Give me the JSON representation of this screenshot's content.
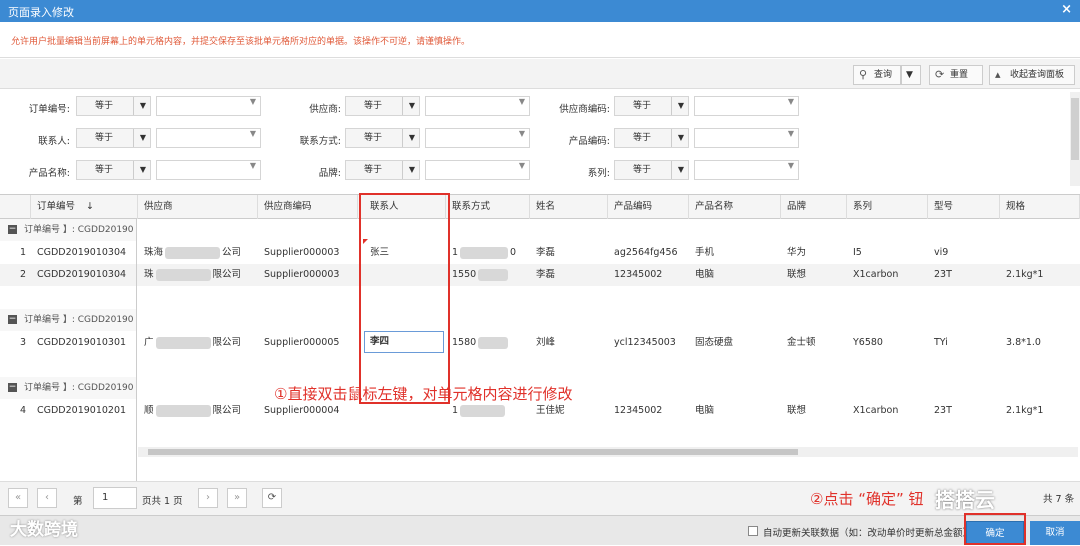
{
  "window": {
    "title": "页面录入修改",
    "close": "×"
  },
  "notice": "允许用户批量编辑当前屏幕上的单元格内容，并提交保存至该批单元格所对应的单据。该操作不可逆，请谨慎操作。",
  "toolbar": {
    "query": "查询",
    "reset": "重置",
    "collapse": "收起查询面板"
  },
  "filters": [
    {
      "label": "订单编号:",
      "op": "等于"
    },
    {
      "label": "供应商:",
      "op": "等于"
    },
    {
      "label": "供应商编码:",
      "op": "等于"
    },
    {
      "label": "联系人:",
      "op": "等于"
    },
    {
      "label": "联系方式:",
      "op": "等于"
    },
    {
      "label": "产品编码:",
      "op": "等于"
    },
    {
      "label": "产品名称:",
      "op": "等于"
    },
    {
      "label": "品牌:",
      "op": "等于"
    },
    {
      "label": "系列:",
      "op": "等于"
    }
  ],
  "table": {
    "headers": [
      "订单编号",
      "供应商",
      "供应商编码",
      "联系人",
      "联系方式",
      "姓名",
      "产品编码",
      "产品名称",
      "品牌",
      "系列",
      "型号",
      "规格"
    ],
    "sort_icon": "↓",
    "group_label": "订单编号",
    "groups": [
      "订单编号 】: CGDD20190",
      "订单编号 】: CGDD20190",
      "订单编号 】: CGDD20190"
    ],
    "rows": [
      {
        "n": "1",
        "order": "CGDD2019010304",
        "sup_a": "珠海",
        "sup_b": "公司",
        "code": "Supplier000003",
        "contact": "张三",
        "phone_a": "1",
        "phone_b": "0",
        "name": "李磊",
        "pcode": "ag2564fg456",
        "pname": "手机",
        "brand": "华为",
        "series": "I5",
        "model": "vi9",
        "spec": ""
      },
      {
        "n": "2",
        "order": "CGDD2019010304",
        "sup_a": "珠",
        "sup_b": "限公司",
        "code": "Supplier000003",
        "contact": "",
        "phone_a": "1550",
        "phone_b": "",
        "name": "李磊",
        "pcode": "12345002",
        "pname": "电脑",
        "brand": "联想",
        "series": "X1carbon",
        "model": "23T",
        "spec": "2.1kg*1"
      },
      {
        "n": "3",
        "order": "CGDD2019010301",
        "sup_a": "广",
        "sup_b": "限公司",
        "code": "Supplier000005",
        "contact": "李四",
        "phone_a": "1580",
        "phone_b": "",
        "name": "刘峰",
        "pcode": "ycl12345003",
        "pname": "固态硬盘",
        "brand": "金士顿",
        "series": "Y6580",
        "model": "TYi",
        "spec": "3.8*1.0"
      },
      {
        "n": "4",
        "order": "CGDD2019010201",
        "sup_a": "顺",
        "sup_b": "限公司",
        "code": "Supplier000004",
        "contact": "",
        "phone_a": "1",
        "phone_b": "",
        "name": "王佳妮",
        "pcode": "12345002",
        "pname": "电脑",
        "brand": "联想",
        "series": "X1carbon",
        "model": "23T",
        "spec": "2.1kg*1"
      }
    ]
  },
  "annotations": {
    "step1": "①直接双击鼠标左键，对单元格内容进行修改",
    "step2": "②点击 “确定”   钮"
  },
  "pager": {
    "first": "«",
    "prev": "‹",
    "page_prefix": "第",
    "page_value": "1",
    "page_suffix": "页共 1 页",
    "next": "›",
    "last": "»",
    "refresh": "⟳",
    "total": "共 7 条"
  },
  "footer": {
    "auto_update": "自动更新关联数据（如：改动单价时更新总金额）",
    "ok": "确定",
    "cancel": "取消"
  },
  "watermarks": {
    "left": "大数跨境",
    "right": "搭搭云"
  },
  "colors": {
    "title_bar": "#3c8ad3",
    "annotation": "#e0312a",
    "notice_text": "#e05a3a"
  }
}
